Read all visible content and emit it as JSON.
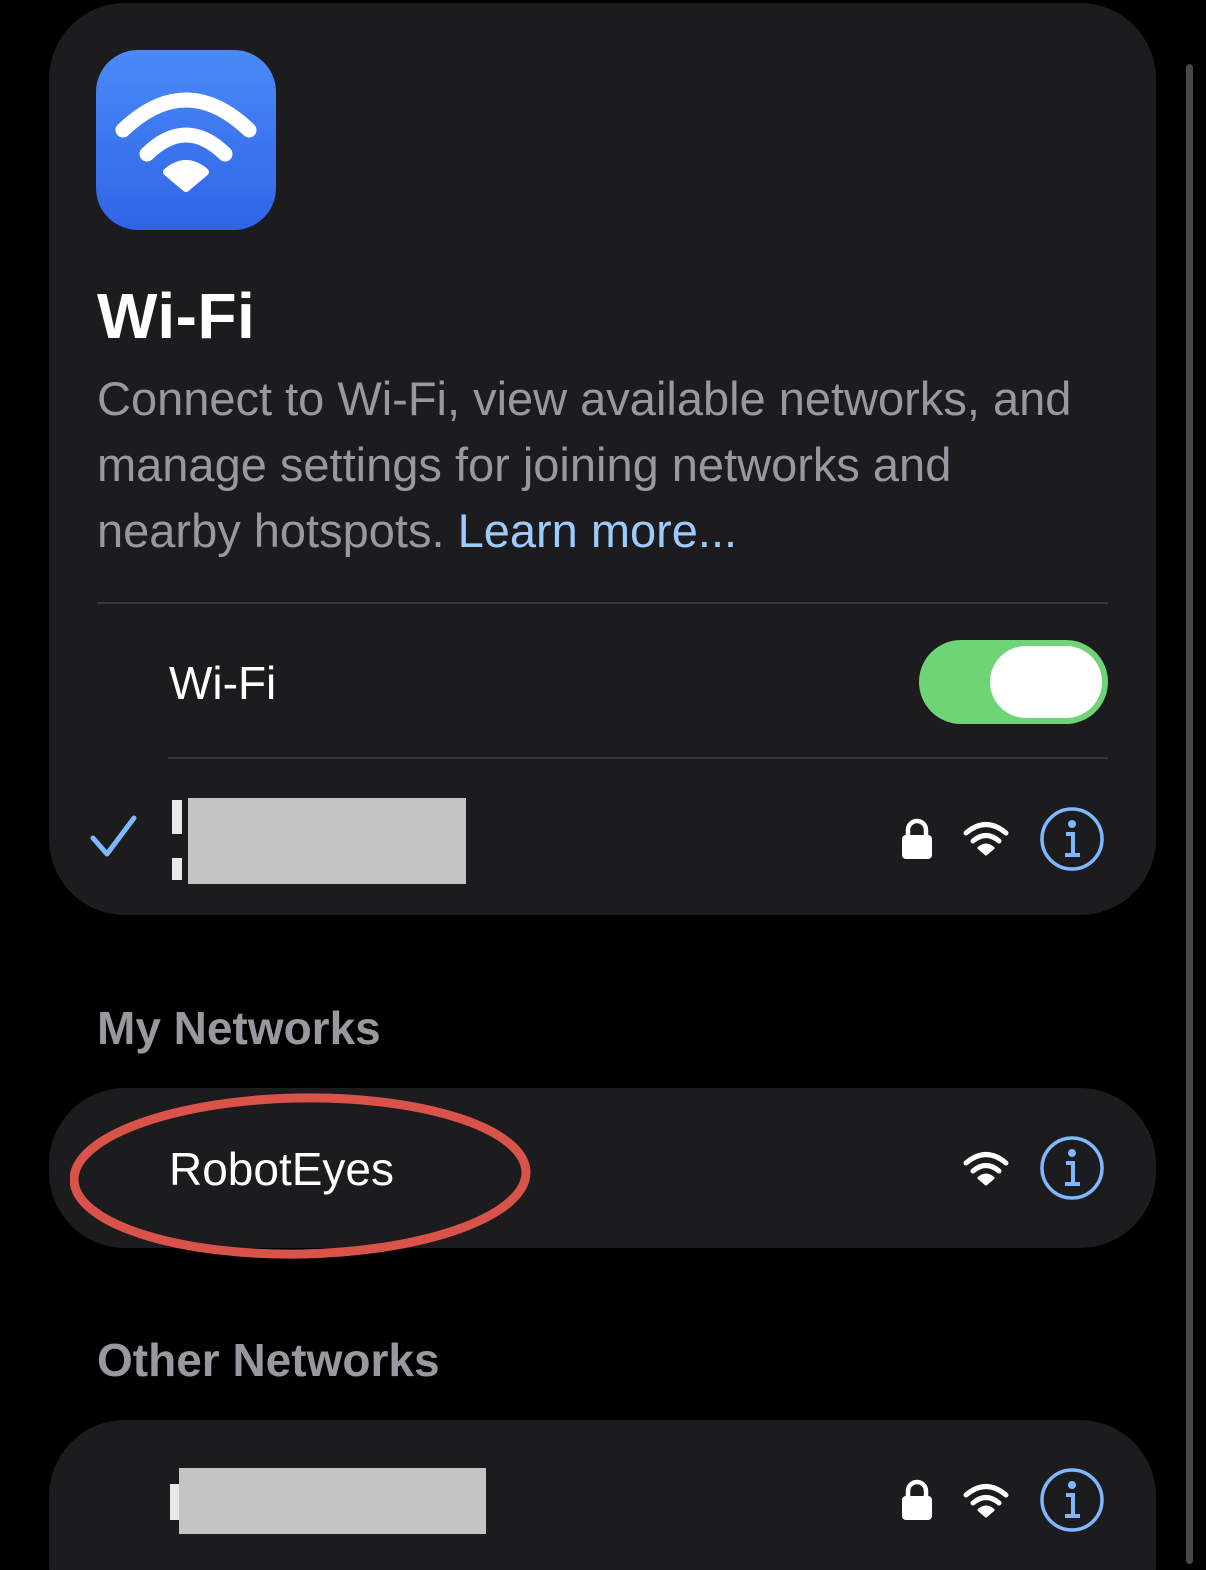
{
  "header": {
    "title": "Wi-Fi",
    "description": "Connect to Wi-Fi, view available networks, and manage settings for joining networks and nearby hotspots.",
    "learn_more": "Learn more...",
    "icon": "wifi-app-icon",
    "icon_colors": [
      "#4a8af6",
      "#2f64e8"
    ]
  },
  "wifi_toggle": {
    "label": "Wi-Fi",
    "on": true,
    "on_color": "#6fd475"
  },
  "current_network": {
    "connected": true,
    "name": "[redacted]",
    "icons": [
      "checkmark-icon",
      "lock-icon",
      "wifi-signal-icon",
      "info-icon"
    ]
  },
  "my_networks": {
    "header": "My Networks",
    "items": [
      {
        "name": "RobotEyes",
        "icons": [
          "wifi-signal-icon",
          "info-icon"
        ],
        "highlighted": true,
        "highlight_color": "#d9534a"
      }
    ]
  },
  "other_networks": {
    "header": "Other Networks",
    "items": [
      {
        "name": "[redacted]",
        "icons": [
          "lock-icon",
          "wifi-signal-icon",
          "info-icon"
        ]
      }
    ]
  },
  "colors": {
    "background": "#000000",
    "card": "#1c1c1e",
    "secondary_text": "#98989f",
    "link": "#9ecbff",
    "accent": "#7fb8ff"
  }
}
